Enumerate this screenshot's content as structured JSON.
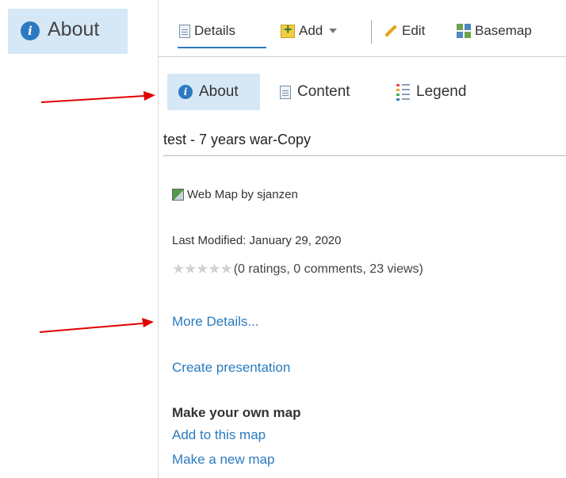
{
  "left_button": {
    "label": "About",
    "icon": "info-icon"
  },
  "toolbar": {
    "details_label": "Details",
    "add_label": "Add",
    "edit_label": "Edit",
    "basemap_label": "Basemap"
  },
  "subtabs": {
    "about_label": "About",
    "content_label": "Content",
    "legend_label": "Legend"
  },
  "item": {
    "title": "test - 7 years war-Copy",
    "type_owner": "Web Map by sjanzen",
    "last_modified": "Last Modified: January 29, 2020",
    "stars": "★★★★★",
    "stats": "(0 ratings, 0 comments, 23 views)"
  },
  "links": {
    "more_details": "More Details...",
    "create_presentation": "Create presentation",
    "make_heading": "Make your own map",
    "add_to_map": "Add to this map",
    "make_new_map": "Make a new map"
  },
  "colors": {
    "accent": "#2c7ac1",
    "selected_bg": "#d6e8f6",
    "link": "#2a7bbf",
    "annotation_arrow": "#e00000"
  }
}
